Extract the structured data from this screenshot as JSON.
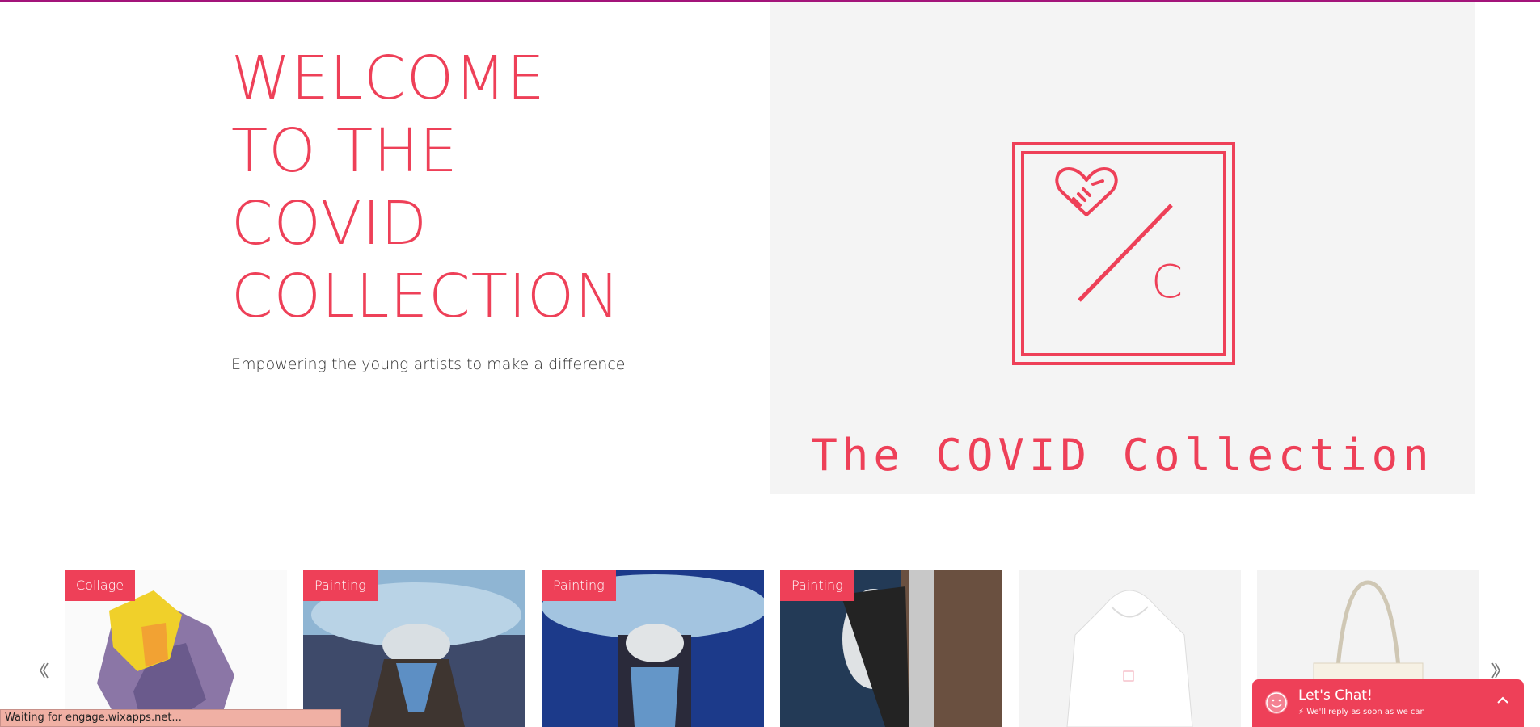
{
  "hero": {
    "title_lines": [
      "WELCOME",
      "TO THE",
      "COVID",
      "COLLECTION"
    ],
    "subtitle": "Empowering the young artists to make a difference"
  },
  "logo": {
    "letter": "C",
    "caption": "The COVID Collection"
  },
  "gallery": {
    "items": [
      {
        "tag": "Collage"
      },
      {
        "tag": "Painting"
      },
      {
        "tag": "Painting"
      },
      {
        "tag": "Painting"
      },
      {
        "tag": ""
      },
      {
        "tag": ""
      }
    ],
    "prev_icon": "chevron-left-icon",
    "next_icon": "chevron-right-icon"
  },
  "status_bar": {
    "text": "Waiting for engage.wixapps.net..."
  },
  "chat": {
    "title": "Let's Chat!",
    "subtitle": "We'll reply as soon as we can"
  },
  "colors": {
    "accent": "#ee4058",
    "panel_bg": "#f4f4f4",
    "top_line": "#a3147a"
  }
}
